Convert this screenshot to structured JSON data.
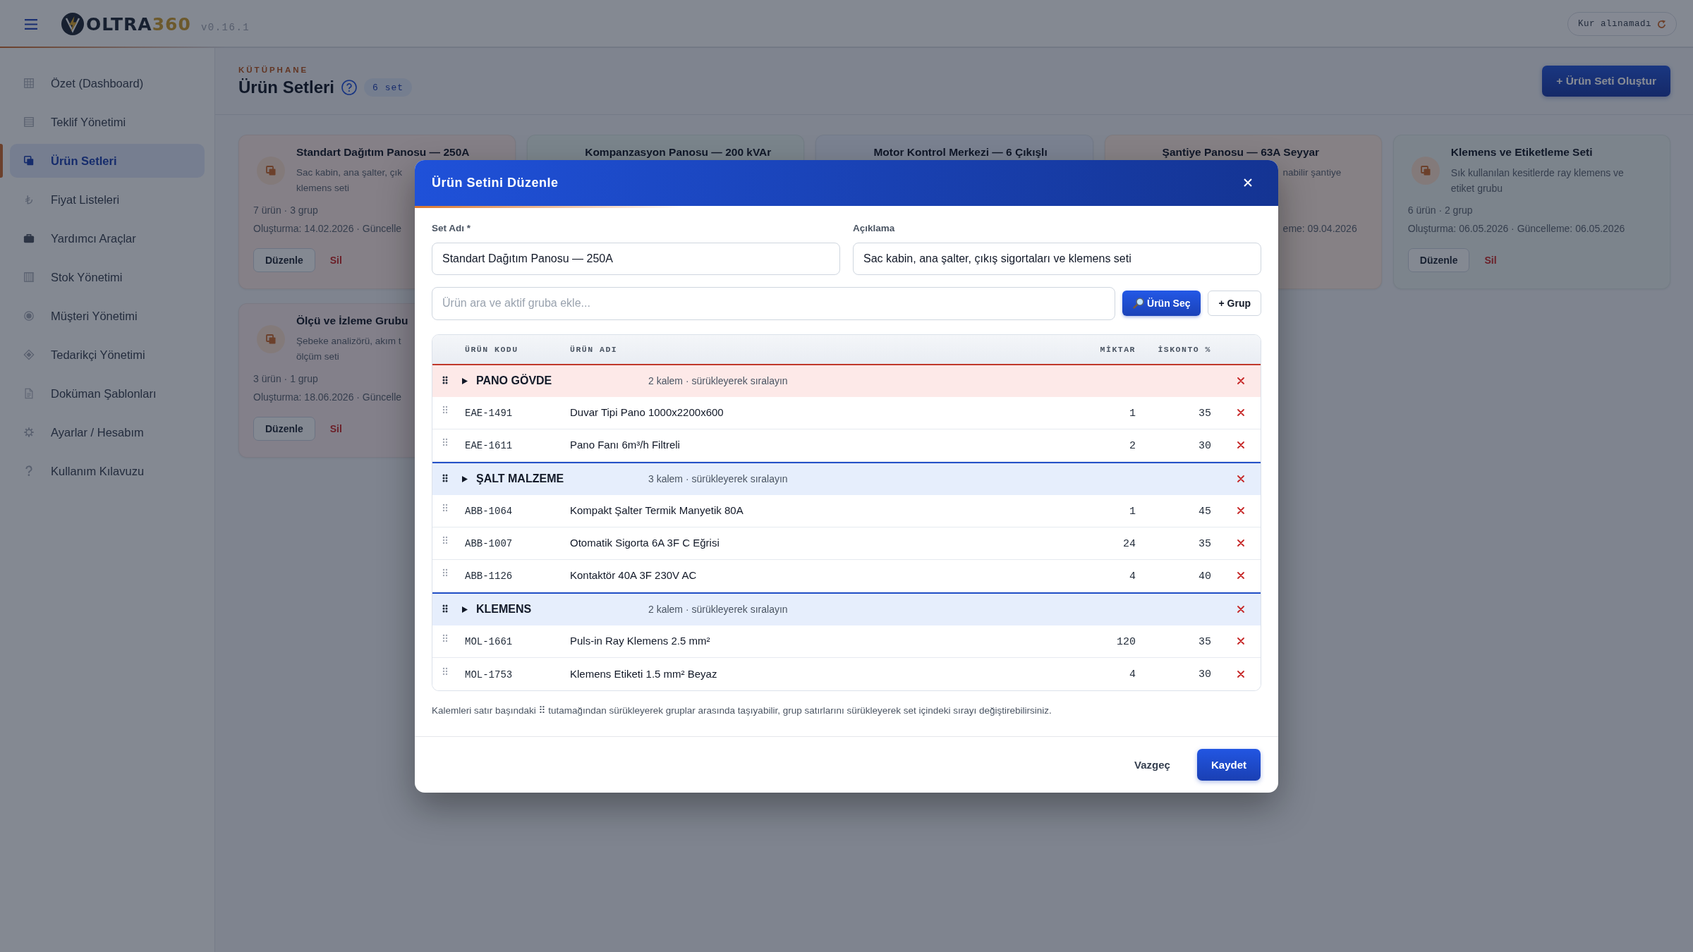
{
  "topbar": {
    "logo_word": "OLTRA",
    "logo_number": "360",
    "version": "v0.16.1",
    "rate_status": "Kur alınamadı"
  },
  "sidebar": {
    "items": [
      {
        "label": "Özet (Dashboard)",
        "selected": false
      },
      {
        "label": "Teklif Yönetimi",
        "selected": false
      },
      {
        "label": "Ürün Setleri",
        "selected": true
      },
      {
        "label": "Fiyat Listeleri",
        "selected": false
      },
      {
        "label": "Yardımcı Araçlar",
        "selected": false
      },
      {
        "label": "Stok Yönetimi",
        "selected": false
      },
      {
        "label": "Müşteri Yönetimi",
        "selected": false
      },
      {
        "label": "Tedarikçi Yönetimi",
        "selected": false
      },
      {
        "label": "Doküman Şablonları",
        "selected": false
      },
      {
        "label": "Ayarlar / Hesabım",
        "selected": false
      },
      {
        "label": "Kullanım Kılavuzu",
        "selected": false
      }
    ]
  },
  "page_header": {
    "eyebrow": "KÜTÜPHANE",
    "title": "Ürün Setleri",
    "count": "6 set",
    "create_button": "+ Ürün Seti Oluştur"
  },
  "cards": [
    {
      "kind": "left_part",
      "color": "#858087",
      "title": "Standart Dağıtım Panosu — 250A",
      "description_parts": [
        "Sac kabin, ana şalter, çık",
        "klemens seti"
      ],
      "counts": "7 ürün · 3 grup",
      "dates": "Oluşturma: 14.02.2026 · Güncelle",
      "edit_button": "Düzenle",
      "delete_button": "Sil"
    },
    {
      "kind": "title_only",
      "color": "#7b858c",
      "title": "Kompanzasyon Panosu — 200 kVAr"
    },
    {
      "kind": "title_only",
      "color": "#7b8291",
      "title": "Motor Kontrol Merkezi — 6 Çıkışlı"
    },
    {
      "kind": "right_part",
      "color": "#868185",
      "title": "Şantiye Panosu — 63A Seyyar",
      "description_parts": [
        "nabilir şantiye"
      ],
      "dates": "eme: 09.04.2026"
    },
    {
      "kind": "full",
      "color": "#7c848c",
      "title": "Klemens ve Etiketleme Seti",
      "description": "Sık kullanılan kesitlerde ray klemens ve etiket grubu",
      "counts": "6 ürün · 2 grup",
      "dates": "Oluşturma: 06.05.2026 · Güncelleme: 06.05.2026",
      "edit_button": "Düzenle",
      "delete_button": "Sil"
    },
    {
      "kind": "left_part",
      "color": "#83808a",
      "title": "Ölçü ve İzleme Grubu",
      "description_parts": [
        "Şebeke analizörü, akım t",
        "ölçüm seti"
      ],
      "counts": "3 ürün · 1 grup",
      "dates": "Oluşturma: 18.06.2026 · Güncelle",
      "edit_button": "Düzenle",
      "delete_button": "Sil"
    }
  ],
  "dialog": {
    "title": "Ürün Setini Düzenle",
    "name_field": {
      "label": "Set Adı *",
      "value": "Standart Dağıtım Panosu — 250A"
    },
    "description_field": {
      "label": "Açıklama",
      "value": "Sac kabin, ana şalter, çıkış sigortaları ve klemens seti"
    },
    "search": {
      "placeholder": "Ürün ara ve aktif gruba ekle..."
    },
    "pick_button": "Ürün Seç",
    "group_button": "+ Grup",
    "table": {
      "columns": [
        "ÜRÜN KODU",
        "ÜRÜN ADI",
        "MİKTAR",
        "İSKONTO %"
      ],
      "groups": [
        {
          "name": "PANO GÖVDE",
          "summary": "2 kalem · sürükleyerek sıralayın",
          "selected": true,
          "items": [
            {
              "code": "EAE-1491",
              "name": "Duvar Tipi Pano 1000x2200x600",
              "quantity": "1",
              "discount": "35"
            },
            {
              "code": "EAE-1611",
              "name": "Pano Fanı 6m³/h Filtreli",
              "quantity": "2",
              "discount": "30"
            }
          ]
        },
        {
          "name": "ŞALT MALZEME",
          "summary": "3 kalem · sürükleyerek sıralayın",
          "selected": false,
          "items": [
            {
              "code": "ABB-1064",
              "name": "Kompakt Şalter Termik Manyetik 80A",
              "quantity": "1",
              "discount": "45"
            },
            {
              "code": "ABB-1007",
              "name": "Otomatik Sigorta 6A 3F C Eğrisi",
              "quantity": "24",
              "discount": "35"
            },
            {
              "code": "ABB-1126",
              "name": "Kontaktör 40A 3F 230V AC",
              "quantity": "4",
              "discount": "40"
            }
          ]
        },
        {
          "name": "KLEMENS",
          "summary": "2 kalem · sürükleyerek sıralayın",
          "selected": false,
          "items": [
            {
              "code": "MOL-1661",
              "name": "Puls-in Ray Klemens 2.5 mm²",
              "quantity": "120",
              "discount": "35"
            },
            {
              "code": "MOL-1753",
              "name": "Klemens Etiketi 1.5 mm² Beyaz",
              "quantity": "4",
              "discount": "30"
            }
          ]
        }
      ]
    },
    "note": "Kalemleri satır başındaki ⠿ tutamağından sürükleyerek gruplar arasında taşıyabilir, grup satırlarını sürükleyerek set içindeki sırayı değiştirebilirsiniz.",
    "cancel_button": "Vazgeç",
    "save_button": "Kaydet"
  }
}
